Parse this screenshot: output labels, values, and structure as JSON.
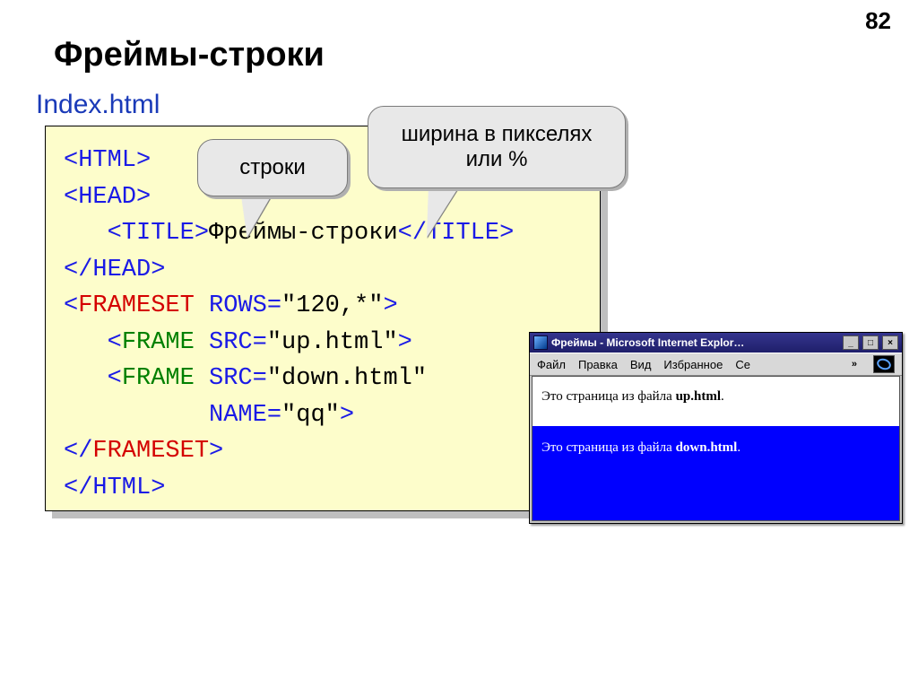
{
  "page_number": "82",
  "heading": "Фреймы-строки",
  "filename": "Index.html",
  "callout1": "строки",
  "callout2": "ширина в пикселях или %",
  "code": {
    "l1": "<HTML>",
    "l2": "<HEAD>",
    "l3a": "   <TITLE>",
    "l3b": "Фреймы-строки",
    "l3c": "</TITLE>",
    "l4": "</HEAD>",
    "l5a": "<",
    "l5b": "FRAMESET",
    "l5c": " ",
    "l5d": "ROWS",
    "l5e": "=",
    "l5f": "\"120,*\"",
    "l5g": ">",
    "l6a": "   <",
    "l6b": "FRAME",
    "l6c": " ",
    "l6d": "SRC",
    "l6e": "=",
    "l6f": "\"up.html\"",
    "l6g": ">",
    "l7a": "   <",
    "l7b": "FRAME",
    "l7c": " ",
    "l7d": "SRC",
    "l7e": "=",
    "l7f": "\"down.html\"",
    "l8a": "          ",
    "l8b": "NAME",
    "l8c": "=",
    "l8d": "\"qq\"",
    "l8e": ">",
    "l9a": "</",
    "l9b": "FRAMESET",
    "l9c": ">",
    "l10": "</HTML>"
  },
  "ie": {
    "title": "Фреймы - Microsoft Internet Explor…",
    "menu": {
      "m1": "Файл",
      "m2": "Правка",
      "m3": "Вид",
      "m4": "Избранное",
      "m5": "Се",
      "chev": "»"
    },
    "top_a": "Это страница из файла ",
    "top_b": "up.html",
    "top_c": ".",
    "bot_a": "Это страница из файла ",
    "bot_b": "down.html",
    "bot_c": "."
  }
}
